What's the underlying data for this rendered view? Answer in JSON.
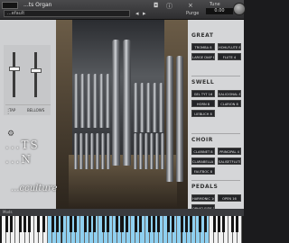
{
  "header": {
    "instrument_name": "...ts Organ",
    "preset_name": "...efault",
    "purge_label": "Purge",
    "tune_label": "Tune",
    "tune_value": "0.00"
  },
  "mixer": {
    "faders": [
      {
        "label": "TAP",
        "level": 0.65
      },
      {
        "label": "BELLOWS",
        "level": 0.6
      }
    ]
  },
  "title": {
    "line1": "...TS",
    "line2": "...N",
    "brand": "...cculture"
  },
  "stops": {
    "sections": [
      {
        "title": "GREAT",
        "buttons": [
          "TROMBA 8",
          "HOHLFLUTE 8",
          "LARGE DIAP 8",
          "FLUTE 4"
        ]
      },
      {
        "title": "SWELL",
        "buttons": [
          "GEL TYT 16",
          "SALICIONAL 8",
          "HORN 8",
          "CLARION 8",
          "LIEBLICH 8"
        ]
      },
      {
        "title": "CHOIR",
        "buttons": [
          "CLARINET 8",
          "PRINCIPAL 4",
          "CLARABELLA 8",
          "SALISETFLUTE 4",
          "FAUTBOC 8"
        ]
      },
      {
        "title": "PEDALS",
        "buttons": [
          "HARMONIC 16",
          "OPEN 16",
          "OPHICLEIDE 16"
        ]
      }
    ]
  },
  "keyboard": {
    "strip_label": "Mods",
    "white_key_count": 52,
    "highlighted_white_keys": [
      10,
      11,
      12,
      13,
      14,
      15,
      16,
      17,
      18,
      19,
      20,
      21,
      22,
      23,
      24,
      25,
      26,
      27,
      28,
      29,
      30,
      31,
      32,
      33,
      34,
      35,
      36,
      37,
      38,
      39,
      40,
      41,
      42,
      43,
      44
    ]
  },
  "colors": {
    "key_highlight": "#8fd0f0",
    "key_white": "#f2f2f2",
    "panel_grey": "#d5d6d8",
    "stop_button": "#232427"
  }
}
